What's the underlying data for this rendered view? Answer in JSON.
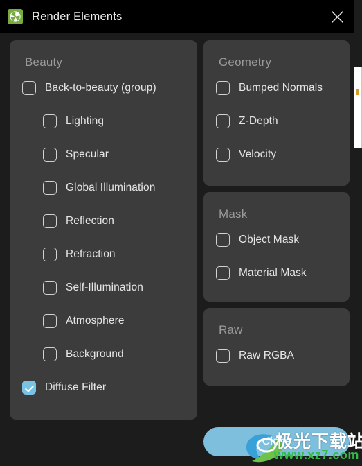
{
  "window": {
    "title": "Render Elements",
    "app_icon": "vray-sphere-icon",
    "close_icon": "close-icon",
    "titlebar_color": "#000000",
    "dialog_background": "#1c1c1c",
    "panel_background": "#3c3c3c"
  },
  "colors": {
    "accent_checkbox": "#79c2e4",
    "accent_button": "#7ebfdd",
    "panel_title": "#9a9a9a",
    "label_text": "#e6e6e6",
    "app_icon_green": "#76ab3f"
  },
  "panels": [
    {
      "id": "beauty",
      "title": "Beauty",
      "column": "left",
      "items": [
        {
          "label": "Back-to-beauty (group)",
          "checked": false,
          "indent": 0
        },
        {
          "label": "Lighting",
          "checked": false,
          "indent": 1
        },
        {
          "label": "Specular",
          "checked": false,
          "indent": 1
        },
        {
          "label": "Global Illumination",
          "checked": false,
          "indent": 1
        },
        {
          "label": "Reflection",
          "checked": false,
          "indent": 1
        },
        {
          "label": "Refraction",
          "checked": false,
          "indent": 1
        },
        {
          "label": "Self-Illumination",
          "checked": false,
          "indent": 1
        },
        {
          "label": "Atmosphere",
          "checked": false,
          "indent": 1
        },
        {
          "label": "Background",
          "checked": false,
          "indent": 1
        },
        {
          "label": "Diffuse Filter",
          "checked": true,
          "indent": 0
        }
      ]
    },
    {
      "id": "geometry",
      "title": "Geometry",
      "column": "right",
      "items": [
        {
          "label": "Bumped Normals",
          "checked": false,
          "indent": 0
        },
        {
          "label": "Z-Depth",
          "checked": false,
          "indent": 0
        },
        {
          "label": "Velocity",
          "checked": false,
          "indent": 0
        }
      ]
    },
    {
      "id": "mask",
      "title": "Mask",
      "column": "right",
      "items": [
        {
          "label": "Object Mask",
          "checked": false,
          "indent": 0
        },
        {
          "label": "Material Mask",
          "checked": false,
          "indent": 0
        }
      ]
    },
    {
      "id": "raw",
      "title": "Raw",
      "column": "right",
      "items": [
        {
          "label": "Raw RGBA",
          "checked": false,
          "indent": 0
        }
      ]
    }
  ],
  "footer": {
    "close_button_label": "Close"
  },
  "watermark": {
    "chinese": "极光下载站",
    "url": "www.xz7.com"
  }
}
